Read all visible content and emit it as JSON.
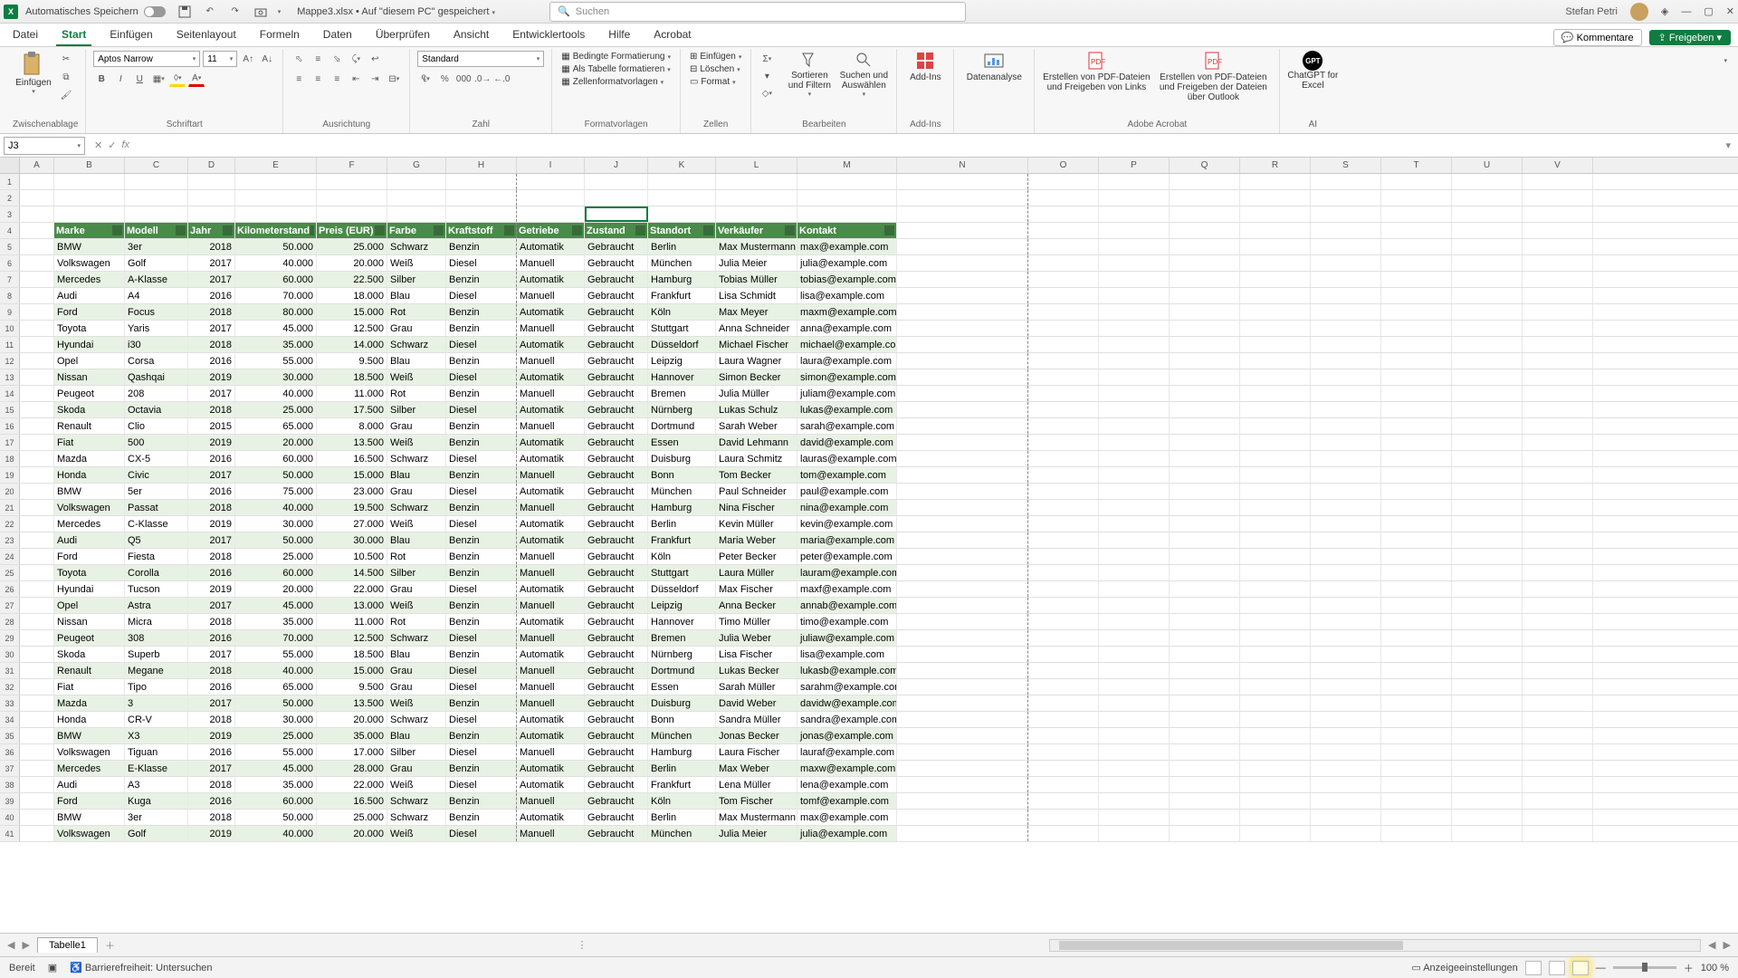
{
  "titlebar": {
    "autosave_label": "Automatisches Speichern",
    "filename": "Mappe3.xlsx • Auf \"diesem PC\" gespeichert",
    "search_placeholder": "Suchen",
    "username": "Stefan Petri"
  },
  "tabs": {
    "items": [
      "Datei",
      "Start",
      "Einfügen",
      "Seitenlayout",
      "Formeln",
      "Daten",
      "Überprüfen",
      "Ansicht",
      "Entwicklertools",
      "Hilfe",
      "Acrobat"
    ],
    "active_index": 1,
    "comments": "Kommentare",
    "share": "Freigeben"
  },
  "ribbon": {
    "clipboard": {
      "paste": "Einfügen",
      "label": "Zwischenablage"
    },
    "font": {
      "name": "Aptos Narrow",
      "size": "11",
      "label": "Schriftart"
    },
    "alignment": {
      "label": "Ausrichtung"
    },
    "number": {
      "format_name": "Standard",
      "label": "Zahl"
    },
    "styles": {
      "cond": "Bedingte Formatierung",
      "as_table": "Als Tabelle formatieren",
      "cell_styles": "Zellenformatvorlagen",
      "label": "Formatvorlagen"
    },
    "cells": {
      "insert": "Einfügen",
      "delete": "Löschen",
      "format": "Format",
      "label": "Zellen"
    },
    "editing": {
      "sort": "Sortieren und Filtern",
      "find": "Suchen und Auswählen",
      "label": "Bearbeiten"
    },
    "addins": {
      "addins": "Add-Ins",
      "label": "Add-Ins"
    },
    "analysis": {
      "btn": "Datenanalyse"
    },
    "acrobat": {
      "pdf1": "Erstellen von PDF-Dateien und Freigeben von Links",
      "pdf2": "Erstellen von PDF-Dateien und Freigeben der Dateien über Outlook",
      "label": "Adobe Acrobat"
    },
    "ai": {
      "gpt": "ChatGPT for Excel",
      "label": "AI"
    }
  },
  "fbar": {
    "cell_ref": "J3"
  },
  "grid": {
    "col_widths": {
      "A": 38,
      "B": 78,
      "C": 70,
      "D": 52,
      "E": 90,
      "F": 78,
      "G": 65,
      "H": 78,
      "I": 75,
      "J": 70,
      "K": 75,
      "L": 90,
      "M": 110,
      "N": 145,
      "extra": 78
    },
    "extra_cols": [
      "N",
      "O",
      "P",
      "Q",
      "R",
      "S",
      "T",
      "U",
      "V"
    ],
    "selected": "J3",
    "headers": [
      "Marke",
      "Modell",
      "Jahr",
      "Kilometerstand",
      "Preis (EUR)",
      "Farbe",
      "Kraftstoff",
      "Getriebe",
      "Zustand",
      "Standort",
      "Verkäufer",
      "Kontakt"
    ],
    "data": [
      [
        "BMW",
        "3er",
        "2018",
        "50.000",
        "25.000",
        "Schwarz",
        "Benzin",
        "Automatik",
        "Gebraucht",
        "Berlin",
        "Max Mustermann",
        "max@example.com"
      ],
      [
        "Volkswagen",
        "Golf",
        "2017",
        "40.000",
        "20.000",
        "Weiß",
        "Diesel",
        "Manuell",
        "Gebraucht",
        "München",
        "Julia Meier",
        "julia@example.com"
      ],
      [
        "Mercedes",
        "A-Klasse",
        "2017",
        "60.000",
        "22.500",
        "Silber",
        "Benzin",
        "Automatik",
        "Gebraucht",
        "Hamburg",
        "Tobias Müller",
        "tobias@example.com"
      ],
      [
        "Audi",
        "A4",
        "2016",
        "70.000",
        "18.000",
        "Blau",
        "Diesel",
        "Manuell",
        "Gebraucht",
        "Frankfurt",
        "Lisa Schmidt",
        "lisa@example.com"
      ],
      [
        "Ford",
        "Focus",
        "2018",
        "80.000",
        "15.000",
        "Rot",
        "Benzin",
        "Automatik",
        "Gebraucht",
        "Köln",
        "Max Meyer",
        "maxm@example.com"
      ],
      [
        "Toyota",
        "Yaris",
        "2017",
        "45.000",
        "12.500",
        "Grau",
        "Benzin",
        "Manuell",
        "Gebraucht",
        "Stuttgart",
        "Anna Schneider",
        "anna@example.com"
      ],
      [
        "Hyundai",
        "i30",
        "2018",
        "35.000",
        "14.000",
        "Schwarz",
        "Diesel",
        "Automatik",
        "Gebraucht",
        "Düsseldorf",
        "Michael Fischer",
        "michael@example.com"
      ],
      [
        "Opel",
        "Corsa",
        "2016",
        "55.000",
        "9.500",
        "Blau",
        "Benzin",
        "Manuell",
        "Gebraucht",
        "Leipzig",
        "Laura Wagner",
        "laura@example.com"
      ],
      [
        "Nissan",
        "Qashqai",
        "2019",
        "30.000",
        "18.500",
        "Weiß",
        "Diesel",
        "Automatik",
        "Gebraucht",
        "Hannover",
        "Simon Becker",
        "simon@example.com"
      ],
      [
        "Peugeot",
        "208",
        "2017",
        "40.000",
        "11.000",
        "Rot",
        "Benzin",
        "Manuell",
        "Gebraucht",
        "Bremen",
        "Julia Müller",
        "juliam@example.com"
      ],
      [
        "Skoda",
        "Octavia",
        "2018",
        "25.000",
        "17.500",
        "Silber",
        "Diesel",
        "Automatik",
        "Gebraucht",
        "Nürnberg",
        "Lukas Schulz",
        "lukas@example.com"
      ],
      [
        "Renault",
        "Clio",
        "2015",
        "65.000",
        "8.000",
        "Grau",
        "Benzin",
        "Manuell",
        "Gebraucht",
        "Dortmund",
        "Sarah Weber",
        "sarah@example.com"
      ],
      [
        "Fiat",
        "500",
        "2019",
        "20.000",
        "13.500",
        "Weiß",
        "Benzin",
        "Automatik",
        "Gebraucht",
        "Essen",
        "David Lehmann",
        "david@example.com"
      ],
      [
        "Mazda",
        "CX-5",
        "2016",
        "60.000",
        "16.500",
        "Schwarz",
        "Diesel",
        "Automatik",
        "Gebraucht",
        "Duisburg",
        "Laura Schmitz",
        "lauras@example.com"
      ],
      [
        "Honda",
        "Civic",
        "2017",
        "50.000",
        "15.000",
        "Blau",
        "Benzin",
        "Manuell",
        "Gebraucht",
        "Bonn",
        "Tom Becker",
        "tom@example.com"
      ],
      [
        "BMW",
        "5er",
        "2016",
        "75.000",
        "23.000",
        "Grau",
        "Diesel",
        "Automatik",
        "Gebraucht",
        "München",
        "Paul Schneider",
        "paul@example.com"
      ],
      [
        "Volkswagen",
        "Passat",
        "2018",
        "40.000",
        "19.500",
        "Schwarz",
        "Benzin",
        "Manuell",
        "Gebraucht",
        "Hamburg",
        "Nina Fischer",
        "nina@example.com"
      ],
      [
        "Mercedes",
        "C-Klasse",
        "2019",
        "30.000",
        "27.000",
        "Weiß",
        "Diesel",
        "Automatik",
        "Gebraucht",
        "Berlin",
        "Kevin Müller",
        "kevin@example.com"
      ],
      [
        "Audi",
        "Q5",
        "2017",
        "50.000",
        "30.000",
        "Blau",
        "Benzin",
        "Automatik",
        "Gebraucht",
        "Frankfurt",
        "Maria Weber",
        "maria@example.com"
      ],
      [
        "Ford",
        "Fiesta",
        "2018",
        "25.000",
        "10.500",
        "Rot",
        "Benzin",
        "Manuell",
        "Gebraucht",
        "Köln",
        "Peter Becker",
        "peter@example.com"
      ],
      [
        "Toyota",
        "Corolla",
        "2016",
        "60.000",
        "14.500",
        "Silber",
        "Benzin",
        "Manuell",
        "Gebraucht",
        "Stuttgart",
        "Laura Müller",
        "lauram@example.com"
      ],
      [
        "Hyundai",
        "Tucson",
        "2019",
        "20.000",
        "22.000",
        "Grau",
        "Diesel",
        "Automatik",
        "Gebraucht",
        "Düsseldorf",
        "Max Fischer",
        "maxf@example.com"
      ],
      [
        "Opel",
        "Astra",
        "2017",
        "45.000",
        "13.000",
        "Weiß",
        "Benzin",
        "Manuell",
        "Gebraucht",
        "Leipzig",
        "Anna Becker",
        "annab@example.com"
      ],
      [
        "Nissan",
        "Micra",
        "2018",
        "35.000",
        "11.000",
        "Rot",
        "Benzin",
        "Automatik",
        "Gebraucht",
        "Hannover",
        "Timo Müller",
        "timo@example.com"
      ],
      [
        "Peugeot",
        "308",
        "2016",
        "70.000",
        "12.500",
        "Schwarz",
        "Diesel",
        "Manuell",
        "Gebraucht",
        "Bremen",
        "Julia Weber",
        "juliaw@example.com"
      ],
      [
        "Skoda",
        "Superb",
        "2017",
        "55.000",
        "18.500",
        "Blau",
        "Benzin",
        "Automatik",
        "Gebraucht",
        "Nürnberg",
        "Lisa Fischer",
        "lisa@example.com"
      ],
      [
        "Renault",
        "Megane",
        "2018",
        "40.000",
        "15.000",
        "Grau",
        "Diesel",
        "Manuell",
        "Gebraucht",
        "Dortmund",
        "Lukas Becker",
        "lukasb@example.com"
      ],
      [
        "Fiat",
        "Tipo",
        "2016",
        "65.000",
        "9.500",
        "Grau",
        "Diesel",
        "Manuell",
        "Gebraucht",
        "Essen",
        "Sarah Müller",
        "sarahm@example.com"
      ],
      [
        "Mazda",
        "3",
        "2017",
        "50.000",
        "13.500",
        "Weiß",
        "Benzin",
        "Manuell",
        "Gebraucht",
        "Duisburg",
        "David Weber",
        "davidw@example.com"
      ],
      [
        "Honda",
        "CR-V",
        "2018",
        "30.000",
        "20.000",
        "Schwarz",
        "Diesel",
        "Automatik",
        "Gebraucht",
        "Bonn",
        "Sandra Müller",
        "sandra@example.com"
      ],
      [
        "BMW",
        "X3",
        "2019",
        "25.000",
        "35.000",
        "Blau",
        "Benzin",
        "Automatik",
        "Gebraucht",
        "München",
        "Jonas Becker",
        "jonas@example.com"
      ],
      [
        "Volkswagen",
        "Tiguan",
        "2016",
        "55.000",
        "17.000",
        "Silber",
        "Diesel",
        "Manuell",
        "Gebraucht",
        "Hamburg",
        "Laura Fischer",
        "lauraf@example.com"
      ],
      [
        "Mercedes",
        "E-Klasse",
        "2017",
        "45.000",
        "28.000",
        "Grau",
        "Benzin",
        "Automatik",
        "Gebraucht",
        "Berlin",
        "Max Weber",
        "maxw@example.com"
      ],
      [
        "Audi",
        "A3",
        "2018",
        "35.000",
        "22.000",
        "Weiß",
        "Diesel",
        "Automatik",
        "Gebraucht",
        "Frankfurt",
        "Lena Müller",
        "lena@example.com"
      ],
      [
        "Ford",
        "Kuga",
        "2016",
        "60.000",
        "16.500",
        "Schwarz",
        "Benzin",
        "Manuell",
        "Gebraucht",
        "Köln",
        "Tom Fischer",
        "tomf@example.com"
      ],
      [
        "BMW",
        "3er",
        "2018",
        "50.000",
        "25.000",
        "Schwarz",
        "Benzin",
        "Automatik",
        "Gebraucht",
        "Berlin",
        "Max Mustermann",
        "max@example.com"
      ],
      [
        "Volkswagen",
        "Golf",
        "2019",
        "40.000",
        "20.000",
        "Weiß",
        "Diesel",
        "Manuell",
        "Gebraucht",
        "München",
        "Julia Meier",
        "julia@example.com"
      ]
    ]
  },
  "sheet": {
    "name": "Tabelle1"
  },
  "status": {
    "ready": "Bereit",
    "access": "Barrierefreiheit: Untersuchen",
    "display": "Anzeigeeinstellungen",
    "zoom": "100 %"
  }
}
